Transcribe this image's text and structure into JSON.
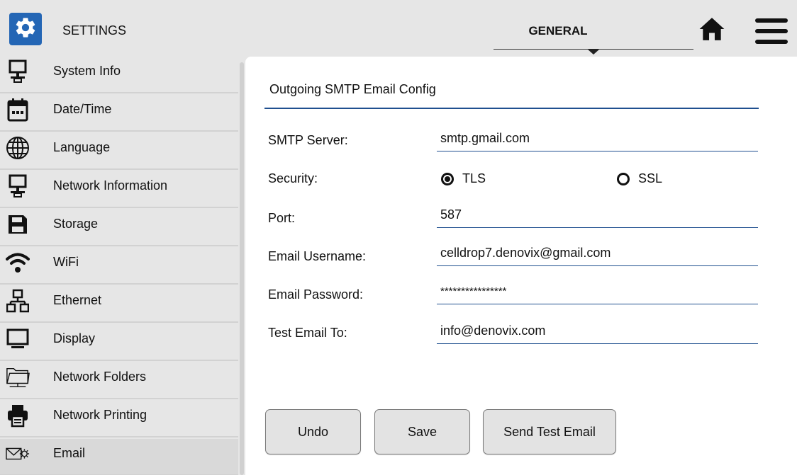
{
  "header": {
    "app_title": "SETTINGS",
    "tab_label": "GENERAL",
    "app_icon": "gear-icon",
    "home_icon": "home-icon",
    "menu_icon": "hamburger-menu-icon",
    "accent_color": "#2466b5"
  },
  "sidebar": {
    "items": [
      {
        "label": "System Info",
        "icon": "monitor-network-icon"
      },
      {
        "label": "Date/Time",
        "icon": "calendar-icon"
      },
      {
        "label": "Language",
        "icon": "globe-icon"
      },
      {
        "label": "Network Information",
        "icon": "monitor-network-icon"
      },
      {
        "label": "Storage",
        "icon": "floppy-disk-icon"
      },
      {
        "label": "WiFi",
        "icon": "wifi-icon"
      },
      {
        "label": "Ethernet",
        "icon": "ethernet-icon"
      },
      {
        "label": "Display",
        "icon": "display-icon"
      },
      {
        "label": "Network Folders",
        "icon": "network-folder-icon"
      },
      {
        "label": "Network Printing",
        "icon": "printer-icon"
      },
      {
        "label": "Email",
        "icon": "email-settings-icon",
        "selected": true
      }
    ]
  },
  "main": {
    "section_title": "Outgoing SMTP Email Config",
    "smtp_server": {
      "label": "SMTP Server:",
      "value": "smtp.gmail.com"
    },
    "security": {
      "label": "Security:",
      "options": [
        "TLS",
        "SSL"
      ],
      "selected": "TLS"
    },
    "port": {
      "label": "Port:",
      "value": "587"
    },
    "email_username": {
      "label": "Email Username:",
      "value": "celldrop7.denovix@gmail.com"
    },
    "email_password": {
      "label": "Email Password:",
      "value": "****************"
    },
    "test_email_to": {
      "label": "Test Email To:",
      "value": "info@denovix.com"
    },
    "buttons": {
      "undo": "Undo",
      "save": "Save",
      "send_test": "Send Test Email"
    }
  }
}
